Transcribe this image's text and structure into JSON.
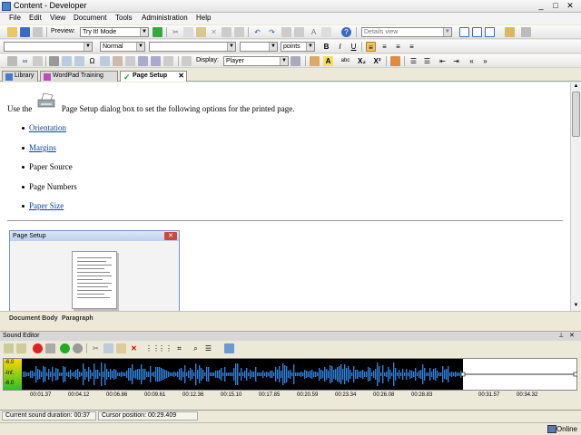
{
  "window": {
    "title": "Content - Developer",
    "controls": {
      "minimize": "_",
      "maximize": "□",
      "close": "✕"
    }
  },
  "menu": [
    "File",
    "Edit",
    "View",
    "Document",
    "Tools",
    "Administration",
    "Help"
  ],
  "toolbar1": {
    "preview_label": "Preview:",
    "preview_mode": "Try It! Mode",
    "view_combo": "Details view"
  },
  "toolbar2": {
    "style": "Normal",
    "font": "",
    "size": "",
    "size_unit": "points",
    "bold": "B",
    "italic": "I",
    "underline": "U",
    "abc": "abc",
    "subscript": "X₂",
    "superscript": "X²"
  },
  "toolbar3": {
    "display_label": "Display:",
    "display_value": "Player",
    "align_icon": "A"
  },
  "tabs": [
    {
      "label": "Library",
      "active": false
    },
    {
      "label": "WordPad Training",
      "active": false
    },
    {
      "label": "Page Setup",
      "active": true
    }
  ],
  "document": {
    "intro_before": "Use the",
    "intro_after": "Page Setup dialog box to set the following options for the printed page.",
    "bullets": [
      {
        "text": "Orientation",
        "link": true
      },
      {
        "text": "Margins",
        "link": true
      },
      {
        "text": "Paper Source",
        "link": false
      },
      {
        "text": "Page Numbers",
        "link": false
      },
      {
        "text": "Paper Size",
        "link": true
      }
    ],
    "dialog_title": "Page Setup",
    "dialog_close": "✕"
  },
  "editor_status": {
    "item1": "Document Body",
    "item2": "Paragraph"
  },
  "sound_editor": {
    "title": "Sound Editor",
    "pin": "📌",
    "close": "✕",
    "meter_labels": [
      "-6.0",
      "-Inf.",
      "-6.0"
    ],
    "timeline": [
      "00:01.37",
      "00:04.12",
      "00:06.86",
      "00:09.61",
      "00:12.36",
      "00:15.10",
      "00:17.85",
      "00:20.59",
      "00:23.34",
      "00:26.08",
      "00:28.83",
      "00:31.57",
      "00:34.32"
    ]
  },
  "status": {
    "duration": "Current sound duration: 00:37",
    "cursor": "Cursor position: 00:29.409"
  },
  "taskbar": {
    "online": "Online"
  },
  "colors": {
    "link": "#0645ad",
    "wave_bg": "#000000",
    "wave_fg": "#2f7fd8",
    "meter_top": "#ffd800",
    "meter_bottom": "#2cc02c"
  }
}
